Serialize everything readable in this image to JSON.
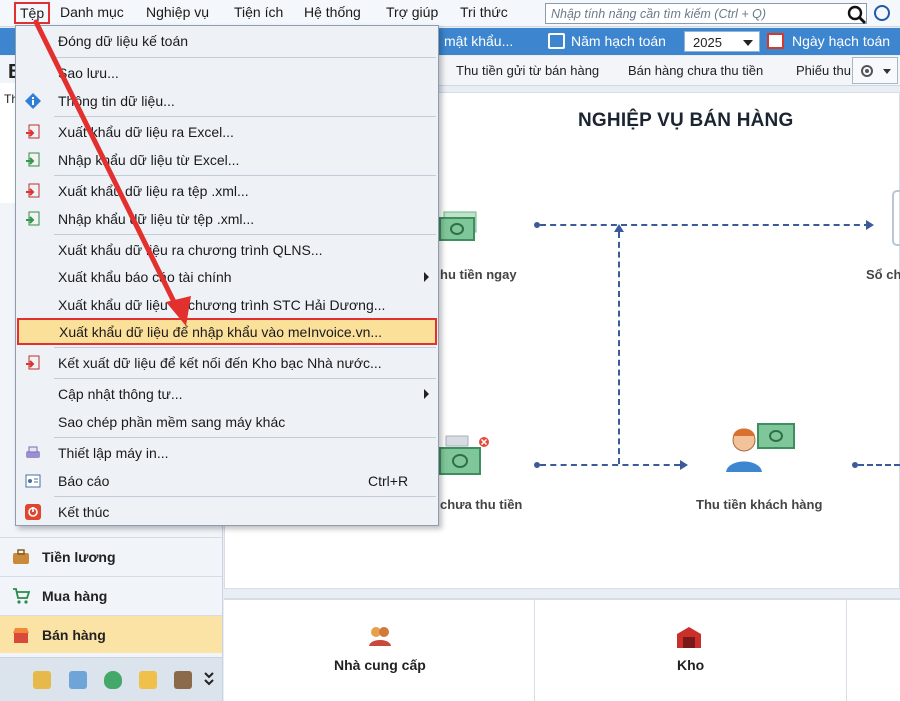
{
  "menubar": {
    "items": [
      "Tệp",
      "Danh mục",
      "Nghiệp vụ",
      "Tiện ích",
      "Hệ thống",
      "Trợ giúp",
      "Tri thức"
    ],
    "search_placeholder": "Nhập tính năng cần tìm kiếm (Ctrl + Q)"
  },
  "toolbar": {
    "password_label": "mật khẩu...",
    "fiscal_year_label": "Năm hạch toán",
    "fiscal_year_value": "2025",
    "posting_date_label": "Ngày hạch toán"
  },
  "tabs": [
    "Thu tiền gửi từ bán hàng",
    "Bán hàng chưa thu tiền",
    "Phiếu thu"
  ],
  "sidebar": {
    "partial_letter": "B",
    "partial_text": "Th",
    "buttons": [
      "Tiền lương",
      "Mua hàng",
      "Bán hàng"
    ],
    "active": "Bán hàng"
  },
  "main": {
    "title": "NGHIỆP VỤ BÁN HÀNG",
    "flow_labels": [
      "hu tiền ngay",
      "Sổ ch",
      "chưa thu tiền",
      "Thu tiền khách hàng"
    ],
    "bottom_labels": [
      "Nhà cung cấp",
      "Kho"
    ]
  },
  "dropdown": {
    "items": [
      {
        "label": "Đóng dữ liệu kế toán",
        "icon": "none"
      },
      {
        "label": "Sao lưu...",
        "icon": "none"
      },
      {
        "label": "Thông tin dữ liệu...",
        "icon": "info-icon"
      },
      {
        "label": "Xuất khẩu dữ liệu ra Excel...",
        "icon": "export-icon"
      },
      {
        "label": "Nhập khẩu dữ liệu từ Excel...",
        "icon": "import-icon"
      },
      {
        "label": "Xuất khẩu dữ liệu ra tệp .xml...",
        "icon": "export-icon"
      },
      {
        "label": "Nhập khẩu dữ liệu từ tệp .xml...",
        "icon": "import-icon"
      },
      {
        "label": "Xuất khẩu dữ liệu ra chương trình QLNS...",
        "icon": "none"
      },
      {
        "label": "Xuất khẩu báo cáo tài chính",
        "icon": "none",
        "submenu": true
      },
      {
        "label": "Xuất khẩu dữ liệu ra chương trình STC Hải Dương...",
        "icon": "none"
      },
      {
        "label": "Xuất khẩu dữ liệu để nhập khẩu vào meInvoice.vn...",
        "icon": "none",
        "highlighted": true
      },
      {
        "label": "Kết xuất dữ liệu để kết nối đến Kho bạc Nhà nước...",
        "icon": "export-icon"
      },
      {
        "label": "Cập nhật thông tư...",
        "icon": "none",
        "submenu": true
      },
      {
        "label": "Sao chép phần mềm sang máy khác",
        "icon": "none"
      },
      {
        "label": "Thiết lập máy in...",
        "icon": "printer-icon"
      },
      {
        "label": "Báo cáo",
        "icon": "report-icon",
        "shortcut": "Ctrl+R"
      },
      {
        "label": "Kết thúc",
        "icon": "exit-icon"
      }
    ]
  },
  "colors": {
    "toolbar_blue": "#3d86cf",
    "highlight_fill": "#fbe09a",
    "annotation_red": "#e2302e",
    "active_sidebar": "#fbe2a5"
  }
}
